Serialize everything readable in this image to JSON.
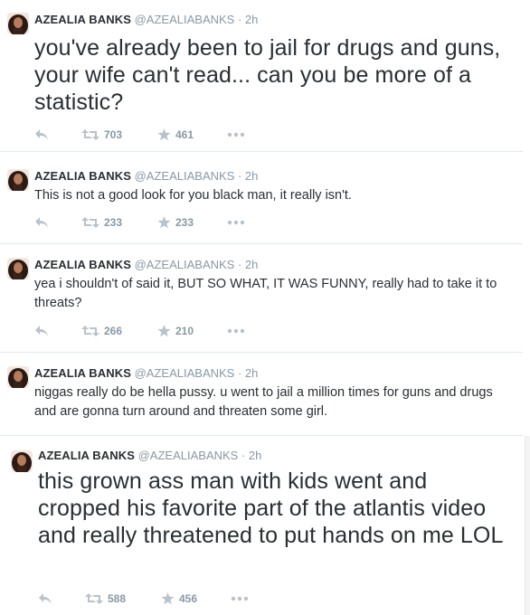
{
  "tweets": [
    {
      "name": "AZEALIA BANKS",
      "handle": "@AZEALIABANKS",
      "time": "· 2h",
      "text": "you've already been to jail for drugs and guns, your wife can't read... can you be more of a statistic?",
      "retweets": "703",
      "favorites": "461"
    },
    {
      "name": "AZEALIA BANKS",
      "handle": "@AZEALIABANKS",
      "time": "· 2h",
      "text": "This is not a good look for you black man, it really isn't.",
      "retweets": "233",
      "favorites": "233"
    },
    {
      "name": "AZEALIA BANKS",
      "handle": "@AZEALIABANKS",
      "time": "· 2h",
      "text": "yea i shouldn't of said it, BUT SO WHAT, IT WAS FUNNY, really had to take it to threats?",
      "retweets": "266",
      "favorites": "210"
    },
    {
      "name": "AZEALIA BANKS",
      "handle": "@AZEALIABANKS",
      "time": "· 2h",
      "text": "niggas really do be hella pussy. u went to jail a million times for guns and drugs and are gonna turn around and threaten some girl.",
      "retweets": "",
      "favorites": ""
    },
    {
      "name": "AZEALIA BANKS",
      "handle": "@AZEALIABANKS",
      "time": "· 2h",
      "text": "this grown ass man with kids went and cropped his favorite part of the atlantis video and really threatened to put hands on me LOL",
      "retweets": "588",
      "favorites": "456"
    }
  ],
  "icons": {
    "reply": "reply-arrow-icon",
    "retweet": "retweet-icon",
    "favorite": "star-icon",
    "more": "more-dots-icon"
  },
  "colors": {
    "text": "#292f33",
    "meta": "#8899a6",
    "icon": "#b8c2cc",
    "divider": "#e1e8ed"
  }
}
